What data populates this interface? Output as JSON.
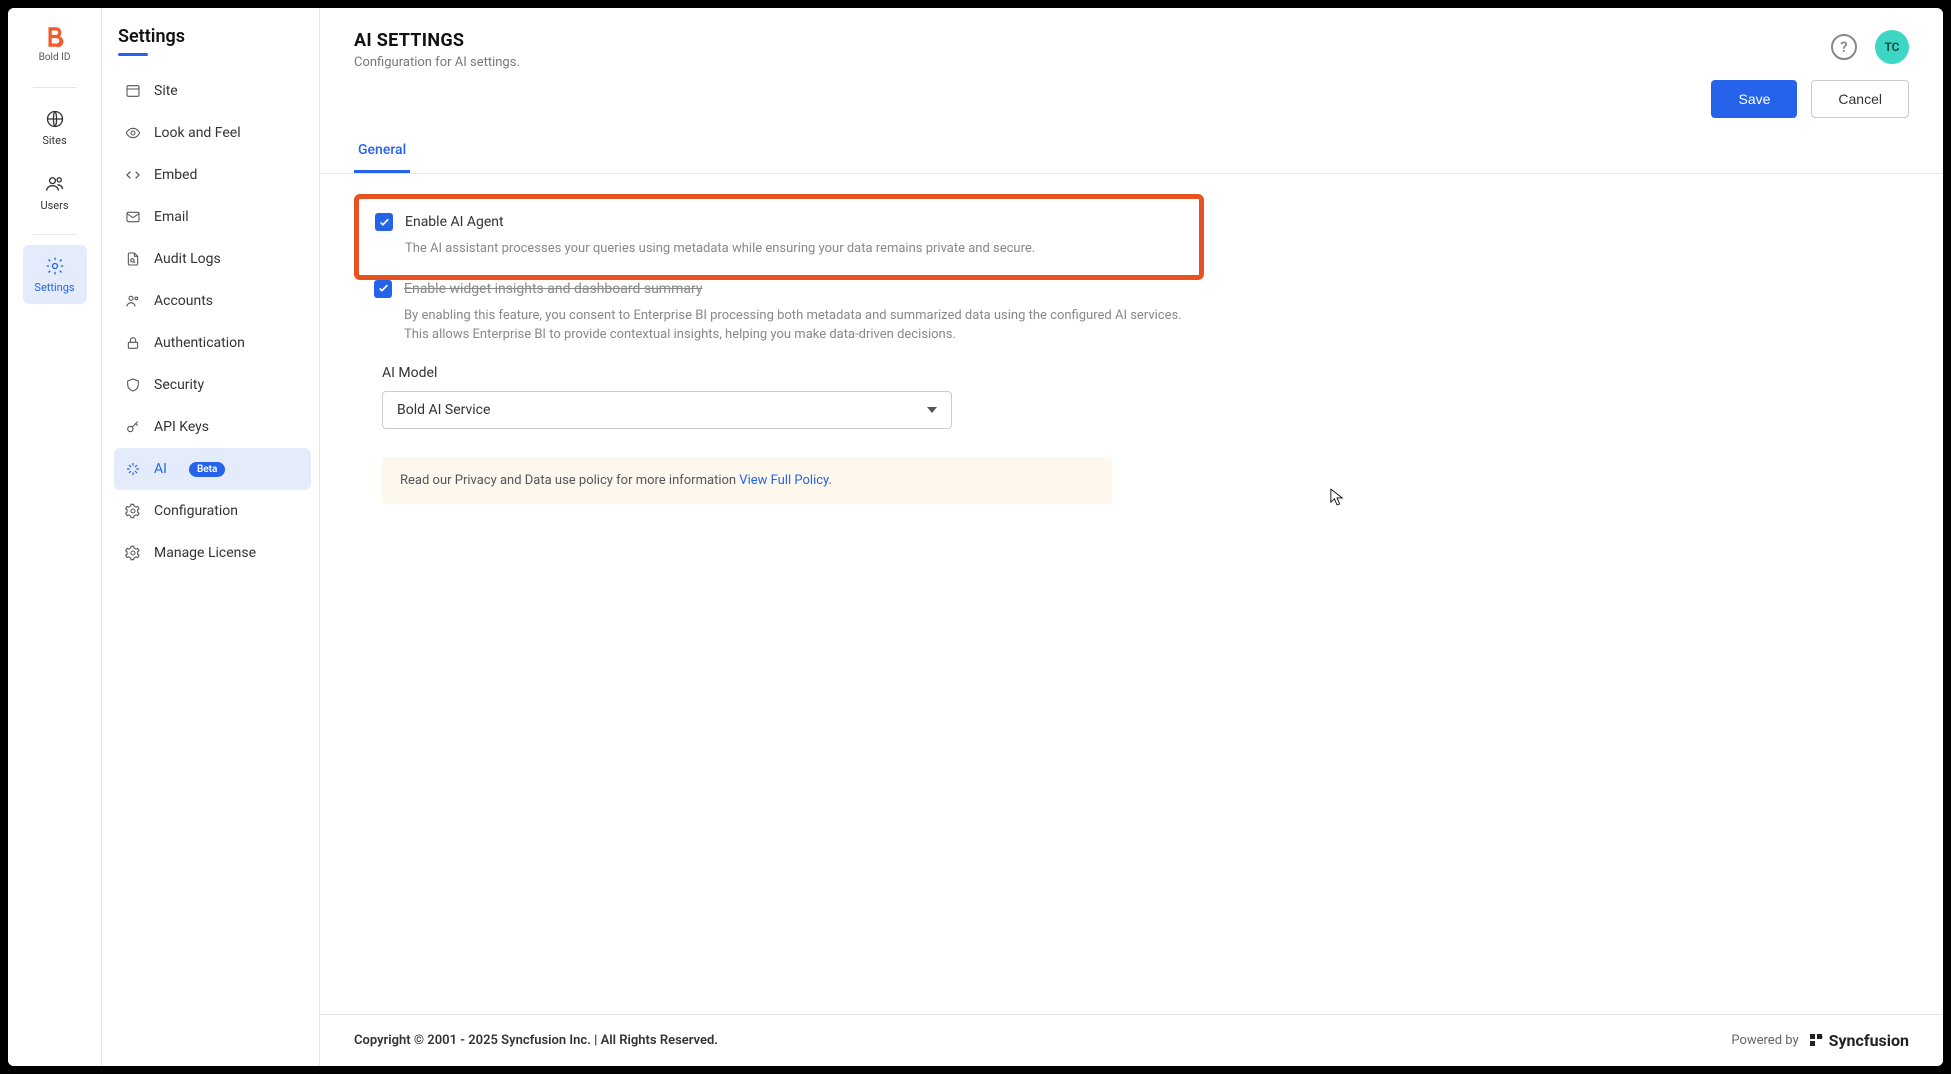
{
  "rail": {
    "logo_label": "Bold ID",
    "items": [
      {
        "label": "Sites"
      },
      {
        "label": "Users"
      },
      {
        "label": "Settings"
      }
    ]
  },
  "sidebar": {
    "title": "Settings",
    "items": [
      {
        "label": "Site"
      },
      {
        "label": "Look and Feel"
      },
      {
        "label": "Embed"
      },
      {
        "label": "Email"
      },
      {
        "label": "Audit Logs"
      },
      {
        "label": "Accounts"
      },
      {
        "label": "Authentication"
      },
      {
        "label": "Security"
      },
      {
        "label": "API Keys"
      },
      {
        "label": "AI",
        "badge": "Beta"
      },
      {
        "label": "Configuration"
      },
      {
        "label": "Manage License"
      }
    ]
  },
  "header": {
    "title": "AI SETTINGS",
    "subtitle": "Configuration for AI settings.",
    "avatar": "TC"
  },
  "actions": {
    "save": "Save",
    "cancel": "Cancel"
  },
  "tabs": {
    "general": "General"
  },
  "settings": {
    "enable_agent": {
      "checked": true,
      "label": "Enable AI Agent",
      "desc": "The AI assistant processes your queries using metadata while ensuring your data remains private and secure."
    },
    "enable_widget": {
      "checked": true,
      "label": "Enable widget insights and dashboard summary",
      "desc": "By enabling this feature, you consent to Enterprise BI processing both metadata and summarized data using the configured AI services. This allows Enterprise BI to provide contextual insights, helping you make data-driven decisions."
    },
    "model": {
      "label": "AI Model",
      "value": "Bold AI Service"
    },
    "policy": {
      "text": "Read our Privacy and Data use policy for more information ",
      "link": "View Full Policy",
      "suffix": "."
    }
  },
  "footer": {
    "copyright": "Copyright © 2001 - 2025 Syncfusion Inc. | All Rights Reserved.",
    "powered": "Powered by",
    "brand": "Syncfusion"
  }
}
